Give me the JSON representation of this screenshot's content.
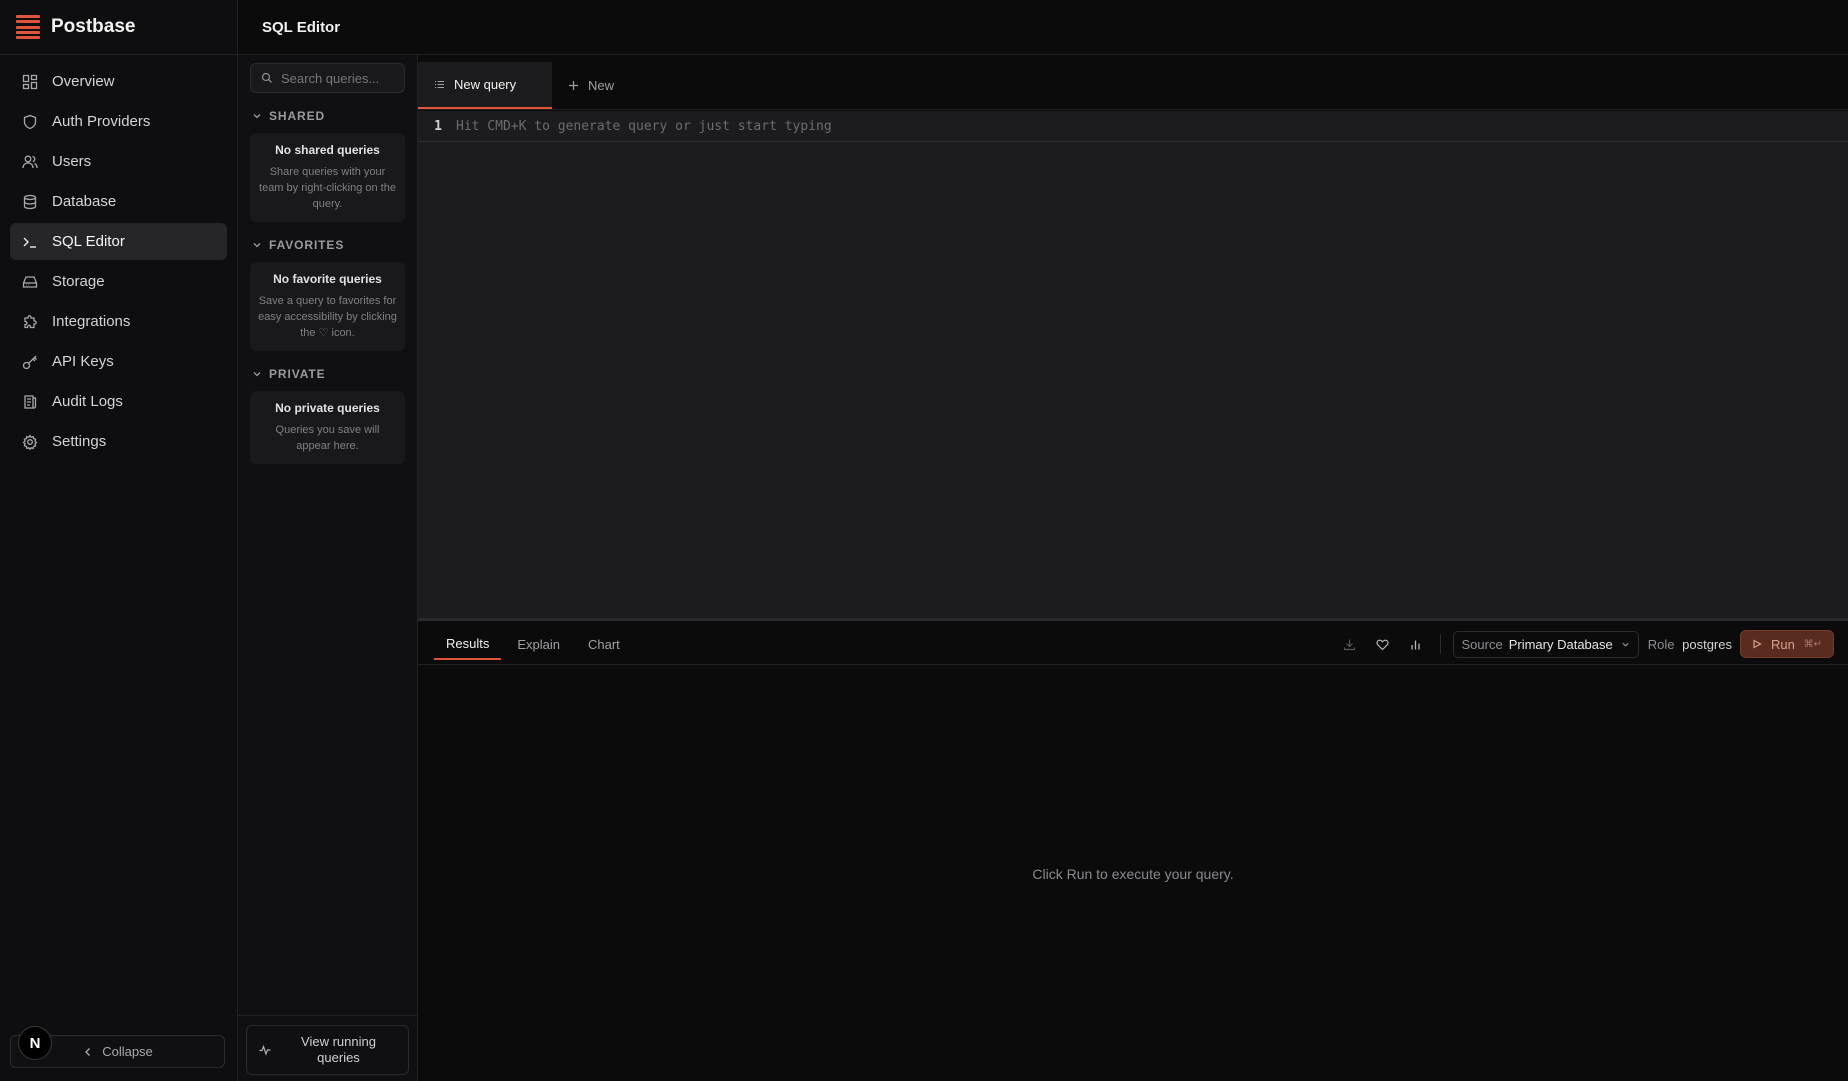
{
  "app": {
    "name": "Postbase"
  },
  "sidebar": {
    "items": [
      {
        "label": "Overview",
        "icon": "dashboard-icon"
      },
      {
        "label": "Auth Providers",
        "icon": "shield-icon"
      },
      {
        "label": "Users",
        "icon": "users-icon"
      },
      {
        "label": "Database",
        "icon": "database-icon"
      },
      {
        "label": "SQL Editor",
        "icon": "terminal-icon",
        "active": true
      },
      {
        "label": "Storage",
        "icon": "drive-icon"
      },
      {
        "label": "Integrations",
        "icon": "puzzle-icon"
      },
      {
        "label": "API Keys",
        "icon": "key-icon"
      },
      {
        "label": "Audit Logs",
        "icon": "logs-icon"
      },
      {
        "label": "Settings",
        "icon": "gear-icon"
      }
    ],
    "collapse_label": "Collapse",
    "avatar_letter": "N"
  },
  "header": {
    "title": "SQL Editor"
  },
  "queries": {
    "search_placeholder": "Search queries...",
    "shared": {
      "heading": "SHARED",
      "empty_title": "No shared queries",
      "empty_desc": "Share queries with your team by right-clicking on the query."
    },
    "favorites": {
      "heading": "FAVORITES",
      "empty_title": "No favorite queries",
      "empty_desc": "Save a query to favorites for easy accessibility by clicking the ♡ icon."
    },
    "private": {
      "heading": "PRIVATE",
      "empty_title": "No private queries",
      "empty_desc": "Queries you save will appear here."
    },
    "running_label": "View running queries"
  },
  "tabs": {
    "active_label": "New query",
    "new_label": "New"
  },
  "editor": {
    "line_number": "1",
    "placeholder": "Hit CMD+K to generate query or just start typing"
  },
  "results": {
    "tabs": [
      "Results",
      "Explain",
      "Chart"
    ],
    "source_label": "Source",
    "source_value": "Primary Database",
    "role_label": "Role",
    "role_value": "postgres",
    "run_label": "Run",
    "run_shortcut": "⌘↵",
    "empty_message": "Click Run to execute your query."
  },
  "colors": {
    "accent": "#e0553a",
    "background": "#0b0b0c",
    "editor_bg": "#1c1c1e",
    "run_bg": "#5a2b1f"
  }
}
